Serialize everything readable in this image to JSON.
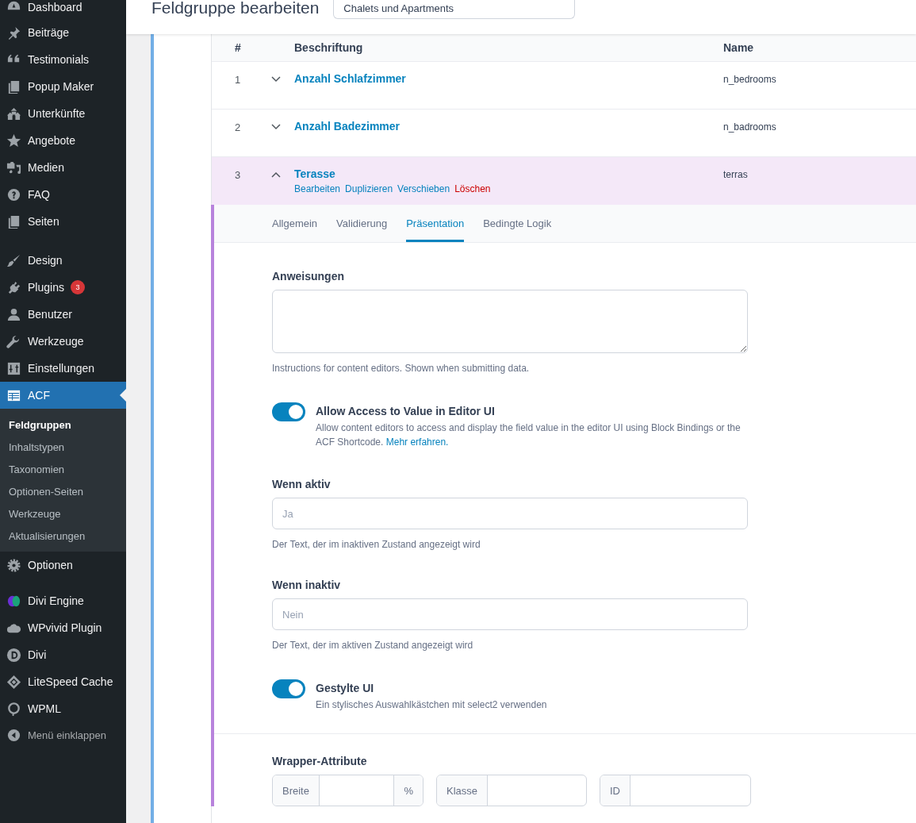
{
  "sidebar": {
    "menu_groups": [
      {
        "items": [
          {
            "label": "Dashboard",
            "selected": false
          }
        ]
      },
      {
        "items": [
          {
            "label": "Beiträge",
            "selected": false
          },
          {
            "label": "Testimonials",
            "selected": false
          },
          {
            "label": "Popup Maker",
            "selected": false
          },
          {
            "label": "Unterkünfte",
            "selected": false
          },
          {
            "label": "Angebote",
            "selected": false
          },
          {
            "label": "Medien",
            "selected": false
          },
          {
            "label": "FAQ",
            "selected": false
          },
          {
            "label": "Seiten",
            "selected": false
          }
        ]
      },
      {
        "items": [
          {
            "label": "Design",
            "selected": false
          },
          {
            "label": "Plugins",
            "selected": false,
            "badge": "3"
          },
          {
            "label": "Benutzer",
            "selected": false
          },
          {
            "label": "Werkzeuge",
            "selected": false
          },
          {
            "label": "Einstellungen",
            "selected": false
          },
          {
            "label": "ACF",
            "selected": true,
            "children": [
              {
                "label": "Feldgruppen",
                "selected": true
              },
              {
                "label": "Inhaltstypen",
                "selected": false
              },
              {
                "label": "Taxonomien",
                "selected": false
              },
              {
                "label": "Optionen-Seiten",
                "selected": false
              },
              {
                "label": "Werkzeuge",
                "selected": false
              },
              {
                "label": "Aktualisierungen",
                "selected": false
              }
            ]
          },
          {
            "label": "Optionen",
            "selected": false
          }
        ]
      },
      {
        "items": [
          {
            "label": "Divi Engine",
            "selected": false
          },
          {
            "label": "WPvivid Plugin",
            "selected": false
          },
          {
            "label": "Divi",
            "selected": false
          },
          {
            "label": "LiteSpeed Cache",
            "selected": false
          },
          {
            "label": "WPML",
            "selected": false
          }
        ]
      }
    ],
    "collapse_label": "Menü einklappen"
  },
  "header": {
    "title": "Feldgruppe bearbeiten",
    "group_title": "Chalets und Apartments"
  },
  "fields_table": {
    "columns": [
      "#",
      "Beschriftung",
      "Name"
    ],
    "rows": [
      {
        "number": "1",
        "label": "Anzahl Schlafzimmer",
        "name": "n_bedrooms",
        "expanded": false,
        "selected": false
      },
      {
        "number": "2",
        "label": "Anzahl Badezimmer",
        "name": "n_badrooms",
        "expanded": false,
        "selected": false
      },
      {
        "number": "3",
        "label": "Terasse",
        "name": "terras",
        "expanded": true,
        "selected": true,
        "actions": [
          {
            "label": "Bearbeiten",
            "kind": "link"
          },
          {
            "label": "Duplizieren",
            "kind": "link"
          },
          {
            "label": "Verschieben",
            "kind": "link"
          },
          {
            "label": "Löschen",
            "kind": "danger"
          }
        ]
      }
    ]
  },
  "field_settings": {
    "tabs": [
      {
        "label": "Allgemein",
        "selected": false
      },
      {
        "label": "Validierung",
        "selected": false
      },
      {
        "label": "Präsentation",
        "selected": true
      },
      {
        "label": "Bedingte Logik",
        "selected": false
      }
    ],
    "settings": [
      {
        "kind": "textarea",
        "label": "Anweisungen",
        "help": "Instructions for content editors. Shown when submitting data."
      },
      {
        "kind": "toggle",
        "label": "Allow Access to Value in Editor UI",
        "on": true,
        "description": "Allow content editors to access and display the field value in the editor UI using Block Bindings or the ACF Shortcode.",
        "link": "Mehr erfahren."
      },
      {
        "kind": "text",
        "label": "Wenn aktiv",
        "placeholder": "Ja",
        "help": "Der Text, der im inaktiven Zustand angezeigt wird"
      },
      {
        "kind": "text",
        "label": "Wenn inaktiv",
        "placeholder": "Nein",
        "help": "Der Text, der im aktiven Zustand angezeigt wird"
      },
      {
        "kind": "toggle",
        "label": "Gestylte UI",
        "on": true,
        "description": "Ein stylisches Auswahlkästchen mit select2 verwenden"
      }
    ],
    "wrapper": {
      "label": "Wrapper-Attribute",
      "inputs": [
        {
          "prefix": "Breite",
          "suffix": "%"
        },
        {
          "prefix": "Klasse"
        },
        {
          "prefix": "ID"
        }
      ]
    }
  }
}
